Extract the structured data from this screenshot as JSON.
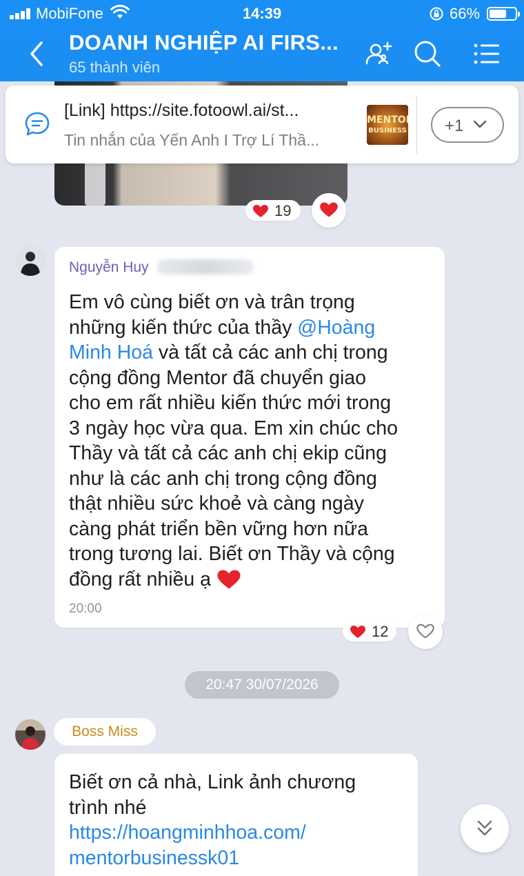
{
  "status_bar": {
    "carrier": "MobiFone",
    "time": "14:39",
    "battery_percent": "66%",
    "battery_level": 0.66,
    "icons": [
      "signal-icon",
      "wifi-icon",
      "rotation-lock-icon",
      "battery-icon"
    ]
  },
  "header": {
    "title": "DOANH NGHIỆP AI FIRS...",
    "members": "65 thành viên",
    "icons": [
      "back-icon",
      "add-member-icon",
      "search-icon",
      "menu-icon"
    ],
    "color": "#1a8ff5"
  },
  "pinned": {
    "title": "[Link] https://site.fotoowl.ai/st...",
    "subtitle": "Tin nhắn của Yến Anh I Trợ Lí Thầ...",
    "thumb_text_top": "MENTOR",
    "thumb_text_bottom": "BUSINESS",
    "more_label": "+1"
  },
  "previous_message": {
    "reaction_count": "19"
  },
  "message_1": {
    "sender": "Nguyễn Huy",
    "lines": [
      {
        "pre": "Em vô cùng biết ơn và trân trọng",
        "mention": "",
        "post": ""
      },
      {
        "pre": "những kiến thức của thầy ",
        "mention": "@Hoàng",
        "post": ""
      },
      {
        "pre": "",
        "mention": "Minh Hoá",
        "post": " và tất cả các anh chị trong"
      },
      {
        "pre": "cộng đồng Mentor đã chuyển giao",
        "mention": "",
        "post": ""
      },
      {
        "pre": "cho em rất nhiều kiến thức mới trong",
        "mention": "",
        "post": ""
      },
      {
        "pre": "3 ngày học vừa qua. Em xin chúc cho",
        "mention": "",
        "post": ""
      },
      {
        "pre": "Thầy và tất cả các anh chị ekip cũng",
        "mention": "",
        "post": ""
      },
      {
        "pre": "như là các anh chị trong cộng đồng",
        "mention": "",
        "post": ""
      },
      {
        "pre": "thật nhiều sức khoẻ và càng ngày",
        "mention": "",
        "post": ""
      },
      {
        "pre": "càng phát triển bền vững hơn nữa",
        "mention": "",
        "post": ""
      },
      {
        "pre": "trong tương lai. Biết ơn Thầy và cộng",
        "mention": "",
        "post": ""
      },
      {
        "pre": "đồng rất nhiều ạ ",
        "mention": "",
        "post": ""
      }
    ],
    "time": "20:00",
    "reaction_count": "12"
  },
  "date_separator": "20:47 30/07/2026",
  "message_2": {
    "sender": "Boss Miss",
    "lines": [
      "Biết ơn cả nhà, Link ảnh chương",
      "trình nhé"
    ],
    "link_lines": [
      "https://hoangminhhoa.com/",
      "mentorbusinessk01"
    ]
  }
}
